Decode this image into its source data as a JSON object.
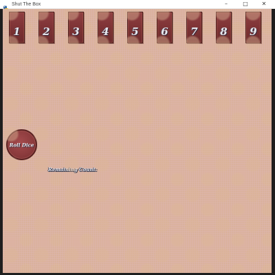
{
  "window": {
    "title": "Shut The Box",
    "app_icon": "python-icon",
    "minimize_label": "–",
    "maximize_label": "□",
    "close_label": "✕"
  },
  "board": {
    "background_color": "#ddb5ab",
    "tile_color": "#7c3234",
    "tiles": [
      "1",
      "2",
      "3",
      "4",
      "5",
      "6",
      "7",
      "8",
      "9"
    ]
  },
  "controls": {
    "roll_dice_label": "Roll Dice"
  },
  "status": {
    "remaining_label": "Remaining Count:"
  }
}
